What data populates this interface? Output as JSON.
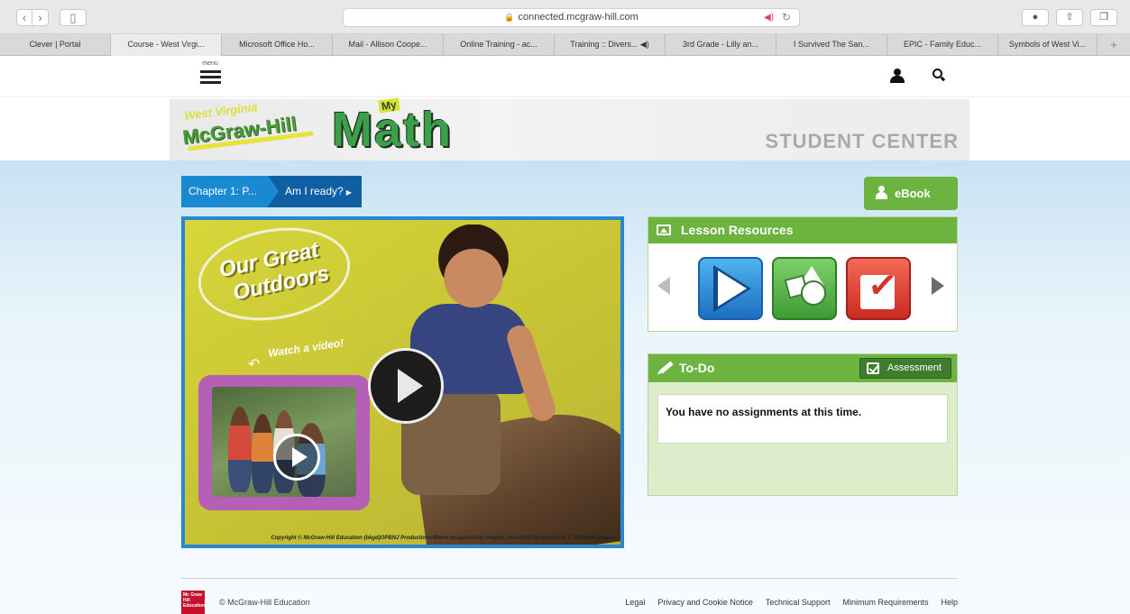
{
  "browser": {
    "back": "‹",
    "forward": "›",
    "sidebar": "▯",
    "url": "connected.mcgraw-hill.com",
    "lock": "🔒",
    "audio": "◀)",
    "reload": "↻",
    "tabs": [
      "Clever | Portal",
      "Course - West Virgi...",
      "Microsoft Office Ho...",
      "Mail - Allison Coope...",
      "Online Training - ac...",
      "Training :: Divers... ◀)",
      "3rd Grade - Lilly an...",
      "I Survived The San...",
      "EPIC - Family Educ...",
      "Symbols of West Vi..."
    ],
    "new_tab": "+"
  },
  "header": {
    "menu_label": "menu",
    "icons": [
      "user-icon",
      "search-icon"
    ]
  },
  "banner": {
    "wv": "West Virginia",
    "mh": "McGraw-Hill",
    "my": "My",
    "math": "Math",
    "student_center": "STUDENT CENTER"
  },
  "breadcrumb": {
    "chapter": "Chapter 1: P...",
    "current": "Am I ready?",
    "caret": "▶"
  },
  "ebook": {
    "label": "eBook"
  },
  "video": {
    "title_line1": "Our Great",
    "title_line2": "Outdoors",
    "watch": "Watch a video!",
    "arrow": "↶",
    "copyright": "Copyright © McGraw-Hill Education (bkgd)OPBNJ Productions/Blend Images/Getty Images; (inset)OERproductions LTD/Blend Images"
  },
  "lesson_resources": {
    "title": "Lesson Resources",
    "items": [
      "video",
      "shapes",
      "check"
    ]
  },
  "todo": {
    "title": "To-Do",
    "assessment": "Assessment",
    "message": "You have no assignments at this time."
  },
  "footer": {
    "logo": "Mc Graw Hill Education",
    "copyright": "© McGraw-Hill Education",
    "links": [
      "Legal",
      "Privacy and Cookie Notice",
      "Technical Support",
      "Minimum Requirements",
      "Help"
    ]
  },
  "colors": {
    "green": "#6db33f",
    "blue": "#1a8ad0",
    "dark_blue": "#0f5fa3",
    "red": "#c8102e"
  }
}
